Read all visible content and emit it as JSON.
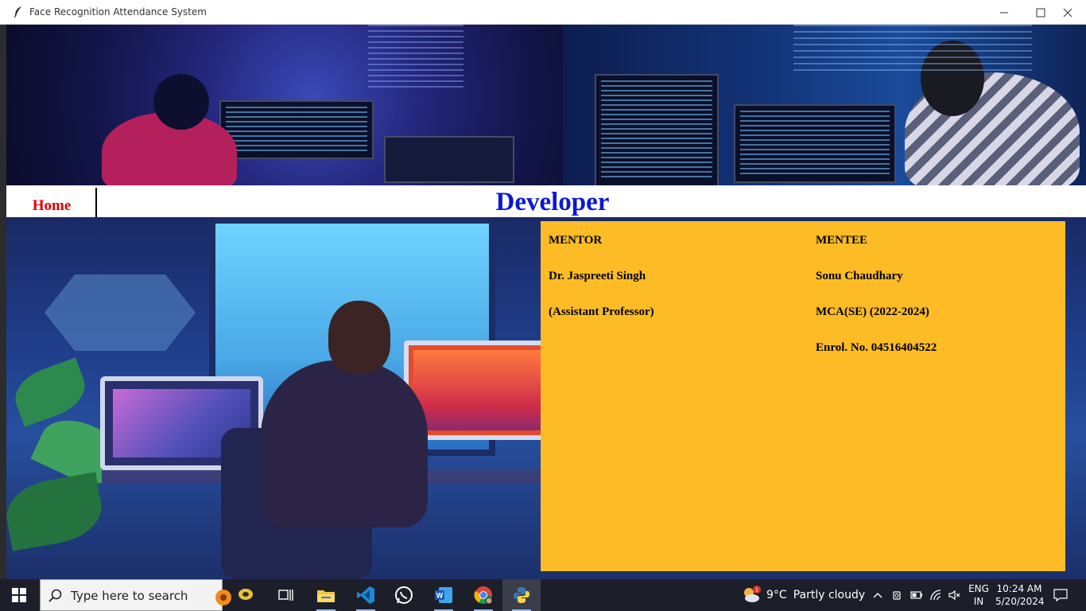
{
  "window": {
    "title": "Face Recognition Attendance System",
    "controls": [
      "minimize",
      "maximize",
      "close"
    ]
  },
  "nav": {
    "home_label": "Home",
    "page_title": "Developer"
  },
  "panel": {
    "mentor": {
      "heading": "MENTOR",
      "name": "Dr. Jaspreeti Singh",
      "role": "(Assistant Professor)"
    },
    "mentee": {
      "heading": "MENTEE",
      "name": "Sonu Chaudhary",
      "course": "MCA(SE) (2022-2024)",
      "enrolment": "Enrol. No. 04516404522"
    },
    "background_color": "#fdbc26"
  },
  "colors": {
    "home_text": "#e00000",
    "title_text": "#0d18d4"
  },
  "taskbar": {
    "search_placeholder": "Type here to search",
    "pinned": [
      "task-view-icon",
      "file-explorer-icon",
      "vscode-icon",
      "whatsapp-icon",
      "word-icon",
      "chrome-icon",
      "python-icon"
    ],
    "weather": {
      "temperature": "9°C",
      "condition": "Partly cloudy",
      "badge": "1"
    },
    "language": {
      "line1": "ENG",
      "line2": "IN"
    },
    "clock": {
      "time": "10:24 AM",
      "date": "5/20/2024"
    }
  }
}
